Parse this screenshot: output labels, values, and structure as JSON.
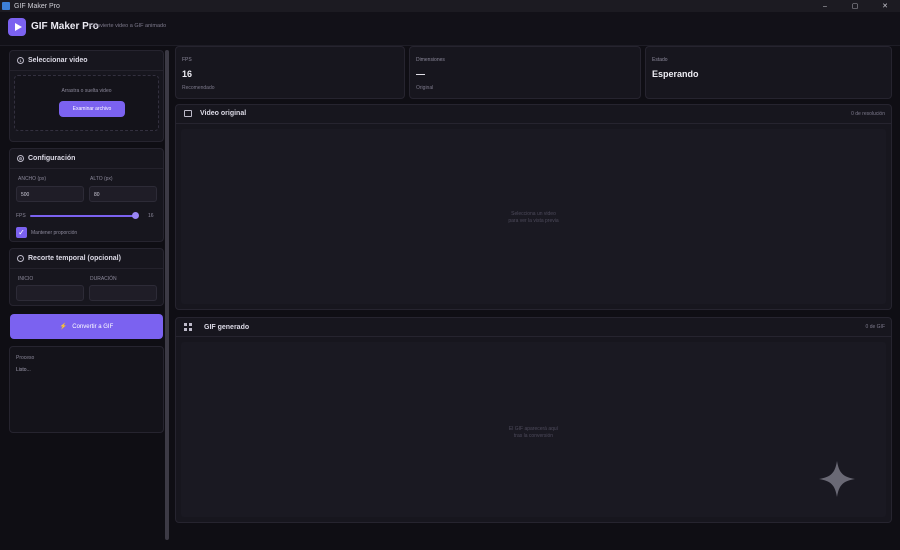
{
  "window": {
    "title": "GIF Maker Pro",
    "controls": [
      "–",
      "▢",
      "✕"
    ]
  },
  "header": {
    "app_name": "GIF Maker Pro",
    "subtitle": "Convierte video a GIF animado"
  },
  "select_video": {
    "title": "Seleccionar video",
    "drop_text": "Arrastra o suelta video",
    "browse_button": "Examinar archivo"
  },
  "config": {
    "title": "Configuración",
    "width_label": "ANCHO (px)",
    "width_value": "500",
    "height_label": "ALTO (px)",
    "height_value": "80",
    "fps_label": "FPS",
    "fps_value": "16",
    "fps_fraction": 0.97,
    "keep_ratio_label": "Mantener proporción",
    "keep_ratio_checked": true
  },
  "trim": {
    "title": "Recorte temporal (opcional)",
    "start_label": "INICIO",
    "duration_label": "DURACIÓN",
    "start_value": "",
    "duration_value": ""
  },
  "convert_button": "Convertir a GIF",
  "console": {
    "title": "Proceso",
    "text": "Listo..."
  },
  "stats": [
    {
      "label": "FPS",
      "value": "16",
      "sub": "Recomendado"
    },
    {
      "label": "Dimensiones",
      "value": "—",
      "sub": "Original"
    },
    {
      "label": "Estado",
      "value": "Esperando",
      "sub": ""
    }
  ],
  "video_panel": {
    "title": "Video original",
    "meta": "0 de resolución",
    "placeholder_line1": "Selecciona un video",
    "placeholder_line2": "para ver la vista previa"
  },
  "gif_panel": {
    "title": "GIF generado",
    "meta": "0 de GIF",
    "placeholder_line1": "El GIF aparecerá aquí",
    "placeholder_line2": "tras la conversión"
  },
  "colors": {
    "accent": "#7b62f0",
    "background": "#0f0e14",
    "card": "#17161e"
  },
  "icons": {
    "logo": "play-icon",
    "convert": "lightning-icon",
    "video": "camera-icon",
    "gif": "grid-icon",
    "corner": "sparkle-icon"
  }
}
